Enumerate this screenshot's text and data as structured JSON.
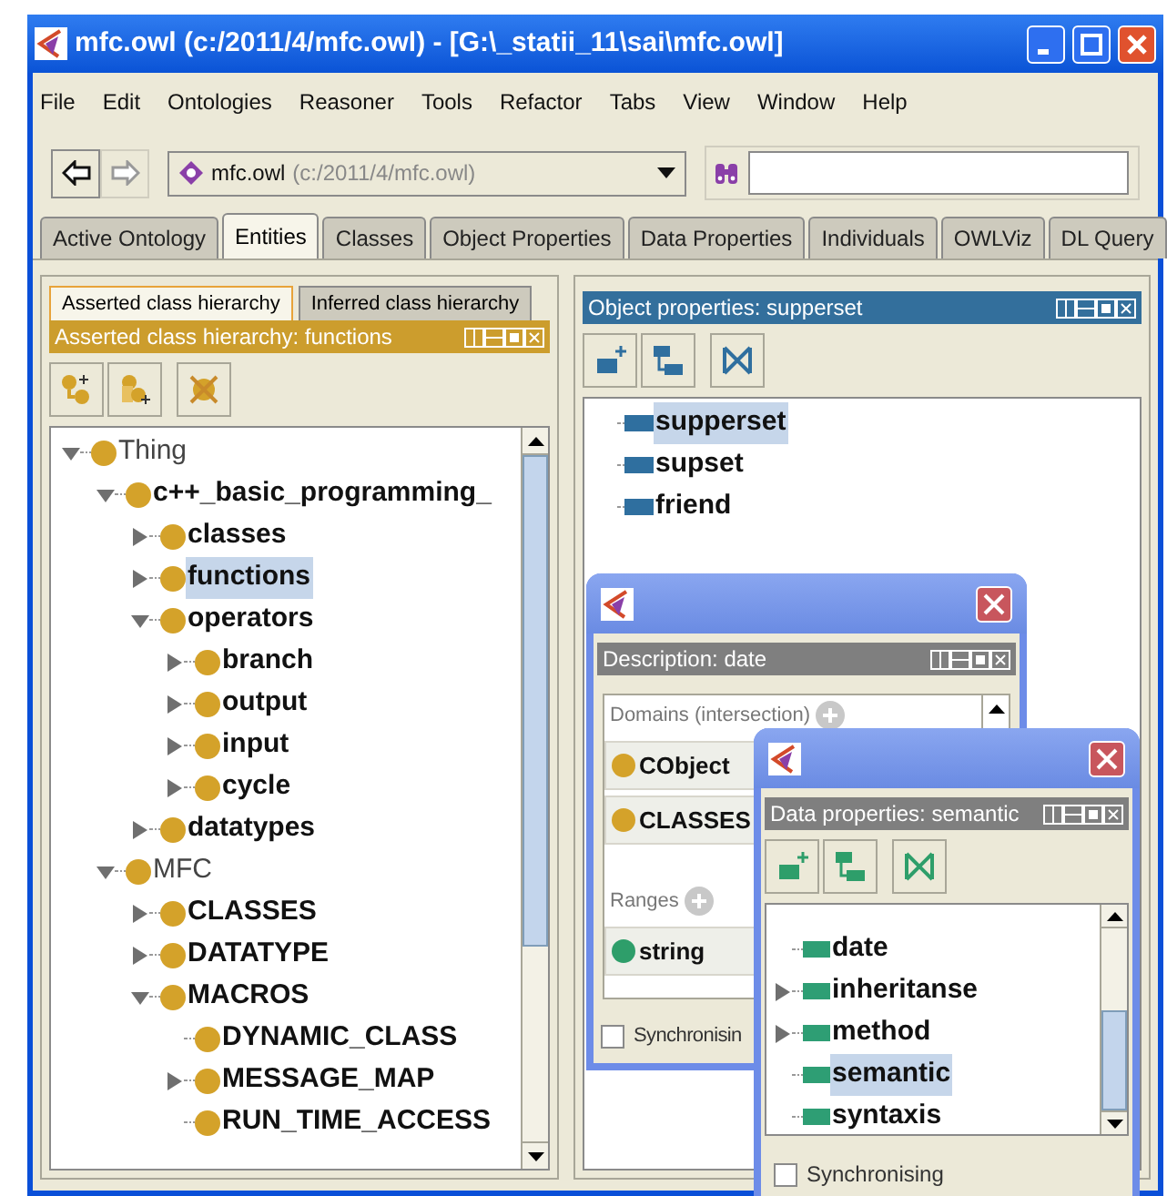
{
  "window": {
    "title": "mfc.owl (c:/2011/4/mfc.owl) - [G:\\_statii_11\\sai\\mfc.owl]"
  },
  "menu": [
    "File",
    "Edit",
    "Ontologies",
    "Reasoner",
    "Tools",
    "Refactor",
    "Tabs",
    "View",
    "Window",
    "Help"
  ],
  "toolbar": {
    "ontology": "mfc.owl",
    "ontology_path": "(c:/2011/4/mfc.owl)"
  },
  "tabs": [
    {
      "label": "Active Ontology",
      "selected": false
    },
    {
      "label": "Entities",
      "selected": true
    },
    {
      "label": "Classes",
      "selected": false
    },
    {
      "label": "Object Properties",
      "selected": false
    },
    {
      "label": "Data Properties",
      "selected": false
    },
    {
      "label": "Individuals",
      "selected": false
    },
    {
      "label": "OWLViz",
      "selected": false
    },
    {
      "label": "DL Query",
      "selected": false
    }
  ],
  "class_panel": {
    "subtabs": [
      {
        "label": "Asserted class hierarchy",
        "selected": true
      },
      {
        "label": "Inferred class hierarchy",
        "selected": false
      }
    ],
    "header": "Asserted class hierarchy: functions",
    "tree": [
      {
        "label": "Thing",
        "bold": false,
        "selected": false,
        "expanded": true,
        "children": [
          {
            "label": "c++_basic_programming_",
            "bold": true,
            "selected": false,
            "expanded": true,
            "children": [
              {
                "label": "classes",
                "bold": true,
                "selected": false,
                "expanded": false
              },
              {
                "label": "functions",
                "bold": true,
                "selected": true,
                "expanded": false
              },
              {
                "label": "operators",
                "bold": true,
                "selected": false,
                "expanded": true,
                "children": [
                  {
                    "label": "branch",
                    "bold": true,
                    "selected": false,
                    "expanded": false
                  },
                  {
                    "label": "output",
                    "bold": true,
                    "selected": false,
                    "expanded": false
                  },
                  {
                    "label": "input",
                    "bold": true,
                    "selected": false,
                    "expanded": false
                  },
                  {
                    "label": "cycle",
                    "bold": true,
                    "selected": false,
                    "expanded": false
                  }
                ]
              },
              {
                "label": "datatypes",
                "bold": true,
                "selected": false,
                "expanded": false
              }
            ]
          },
          {
            "label": "MFC",
            "bold": false,
            "selected": false,
            "expanded": true,
            "children": [
              {
                "label": "CLASSES",
                "bold": true,
                "selected": false,
                "expanded": false
              },
              {
                "label": "DATATYPE",
                "bold": true,
                "selected": false,
                "expanded": false
              },
              {
                "label": "MACROS",
                "bold": true,
                "selected": false,
                "expanded": true,
                "children": [
                  {
                    "label": "DYNAMIC_CLASS",
                    "bold": true,
                    "selected": false
                  },
                  {
                    "label": "MESSAGE_MAP",
                    "bold": true,
                    "selected": false,
                    "expanded": false
                  },
                  {
                    "label": "RUN_TIME_ACCESS",
                    "bold": true,
                    "selected": false
                  }
                ]
              }
            ]
          }
        ]
      }
    ]
  },
  "object_panel": {
    "header": "Object properties: supperset",
    "items": [
      {
        "label": "supperset",
        "selected": true
      },
      {
        "label": "supset",
        "selected": false
      },
      {
        "label": "friend",
        "selected": false
      }
    ]
  },
  "description_window": {
    "header": "Description: date",
    "domains_label": "Domains (intersection)",
    "domains": [
      {
        "label": "CObject"
      },
      {
        "label": "CLASSES"
      }
    ],
    "ranges_label": "Ranges",
    "ranges": [
      {
        "label": "string"
      }
    ],
    "synchronising": {
      "label": "Synchronisin",
      "checked": false
    }
  },
  "data_window": {
    "header": "Data properties: semantic",
    "items": [
      {
        "label": "date",
        "selected": false
      },
      {
        "label": "inheritanse",
        "selected": false,
        "expanded": false
      },
      {
        "label": "method",
        "selected": false,
        "expanded": false
      },
      {
        "label": "semantic",
        "selected": true
      },
      {
        "label": "syntaxis",
        "selected": false
      }
    ],
    "synchronising": {
      "label": "Synchronising",
      "checked": false
    }
  }
}
